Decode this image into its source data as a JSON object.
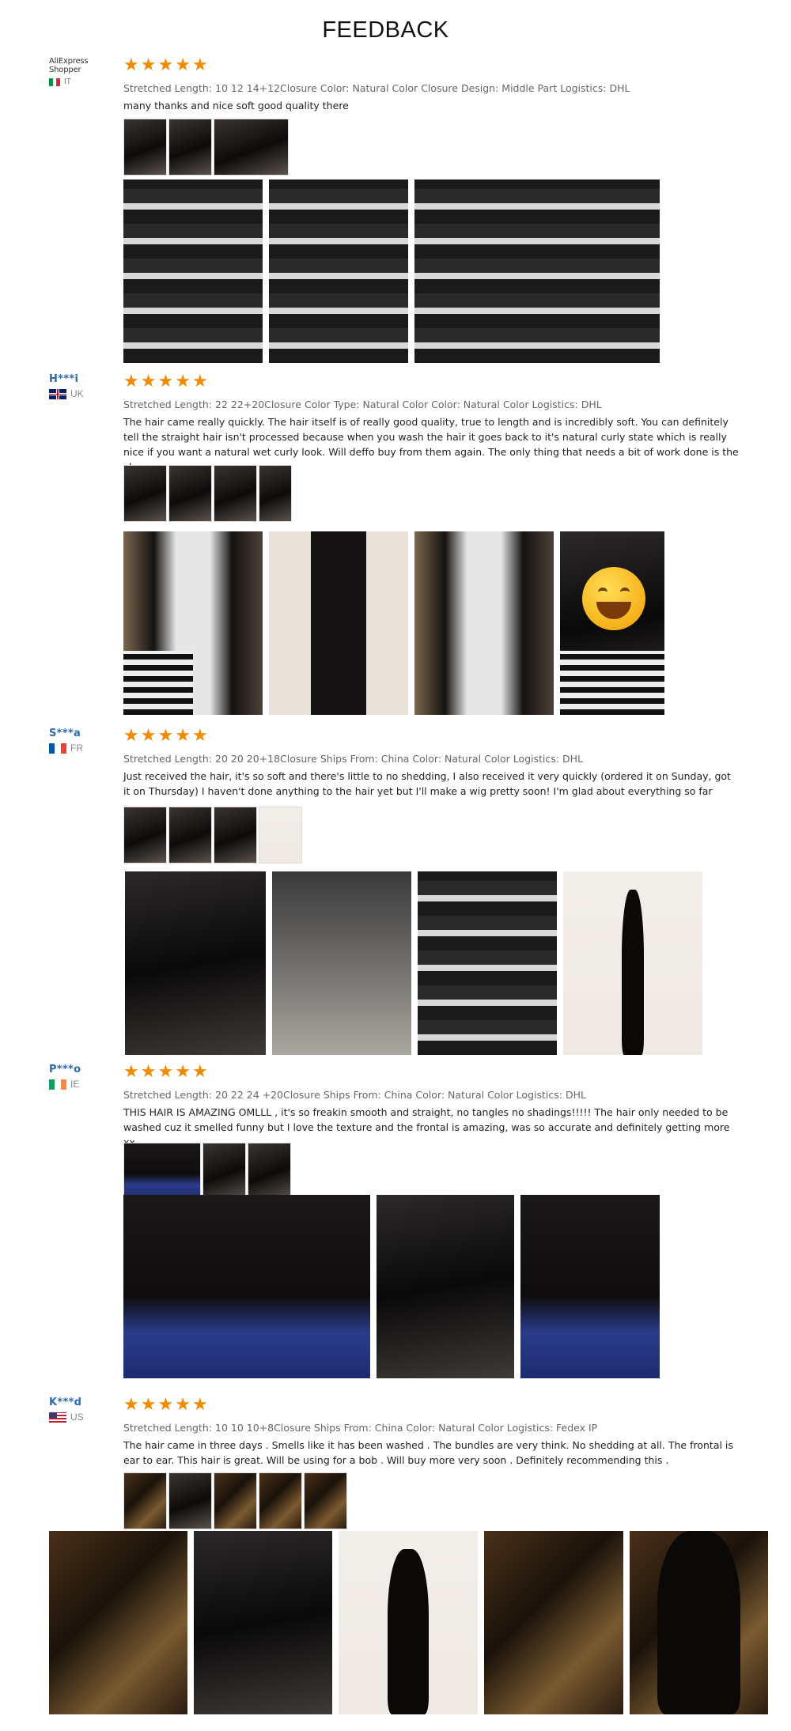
{
  "title": "FEEDBACK",
  "colors": {
    "star": "#f08a00",
    "username": "#2a6ab0",
    "attrs": "#666666"
  },
  "reviews": [
    {
      "user": "AliExpress Shopper",
      "country": "IT",
      "flag": [
        "#009246",
        "#ffffff",
        "#ce2b37"
      ],
      "stars": 5,
      "attrs": "Stretched Length: 10 12 14+12Closure Color: Natural Color Closure Design: Middle Part Logistics: DHL",
      "text": "many thanks and nice soft good quality there",
      "thumb_count": 3,
      "photo_count": 3
    },
    {
      "user": "H***i",
      "country": "UK",
      "flag": [
        "#012169",
        "#ffffff",
        "#c8102e"
      ],
      "stars": 5,
      "attrs": "Stretched Length: 22 22+20Closure Color Type: Natural Color Color: Natural Color Logistics: DHL",
      "text": "The hair came really quickly. The hair itself is of really good quality, true to length and is incredibly soft. You can definitely tell the straight hair isn't processed because when you wash the hair it goes back to it's natural curly state which is really nice if you want a natural wet curly look. Will deffo buy from them again. The only thing that needs a bit of work done is the closure.",
      "thumb_count": 4,
      "photo_count": 4
    },
    {
      "user": "S***a",
      "country": "FR",
      "flag": [
        "#0055a4",
        "#ffffff",
        "#ef4135"
      ],
      "stars": 5,
      "attrs": "Stretched Length: 20 20 20+18Closure Ships From: China Color: Natural Color Logistics: DHL",
      "text": "Just received the hair, it's so soft and there's little to no shedding, I also received it very quickly (ordered it on Sunday, got it on Thursday) I haven't done anything to the hair yet but I'll make a wig pretty soon! I'm glad about everything so far",
      "thumb_count": 4,
      "photo_count": 4
    },
    {
      "user": "P***o",
      "country": "IE",
      "flag": [
        "#169b62",
        "#ffffff",
        "#ff883e"
      ],
      "stars": 5,
      "attrs": "Stretched Length: 20 22 24 +20Closure Ships From: China Color: Natural Color Logistics: DHL",
      "text": "THIS HAIR IS AMAZING OMLLL , it's so freakin smooth and straight, no tangles no shadings!!!!! The hair only needed to be washed cuz it smelled funny but I love the texture and the frontal is amazing, was so accurate and definitely getting more xx",
      "thumb_count": 3,
      "photo_count": 3
    },
    {
      "user": "K***d",
      "country": "US",
      "flag": [
        "#b22234",
        "#ffffff",
        "#3c3b6e"
      ],
      "stars": 5,
      "attrs": "Stretched Length: 10 10 10+8Closure Ships From: China Color: Natural Color Logistics: Fedex IP",
      "text": "The hair came in three days . Smells like it has been washed . The bundles are very think. No shedding at all. The frontal is ear to ear. This hair is great. Will be using for a bob . Will buy more very soon . Definitely recommending this .",
      "thumb_count": 5,
      "photo_count": 5
    }
  ]
}
